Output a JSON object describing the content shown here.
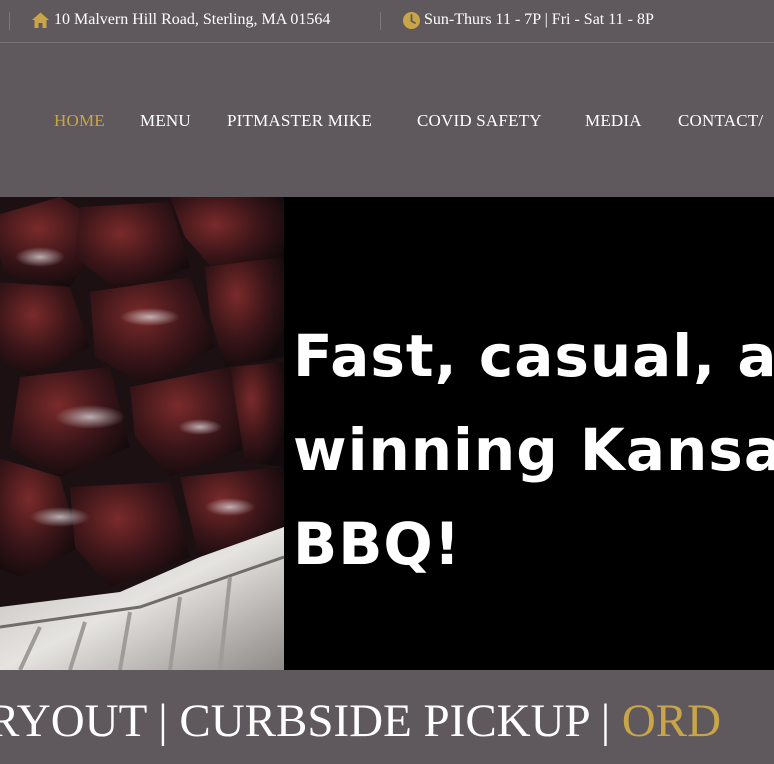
{
  "topbar": {
    "address": "10 Malvern Hill Road, Sterling, MA 01564",
    "address_icon": "home-icon",
    "hours": "Sun-Thurs 11 - 7P | Fri - Sat 11 - 8P",
    "hours_icon": "clock-icon",
    "icon_color": "#c9a54a"
  },
  "nav": {
    "items": [
      {
        "label": "HOME",
        "active": true
      },
      {
        "label": "MENU",
        "active": false
      },
      {
        "label": "PITMASTER MIKE",
        "active": false
      },
      {
        "label": "COVID SAFETY",
        "active": false
      },
      {
        "label": "MEDIA",
        "active": false
      },
      {
        "label": "CONTACT/",
        "active": false
      }
    ],
    "active_color": "#c9a54a"
  },
  "hero": {
    "headline": "Fast, casual, a\nwinning Kansa\nBBQ!"
  },
  "banner": {
    "part1": "RYOUT | CURBSIDE PICKUP | ",
    "part2": "ORD"
  }
}
